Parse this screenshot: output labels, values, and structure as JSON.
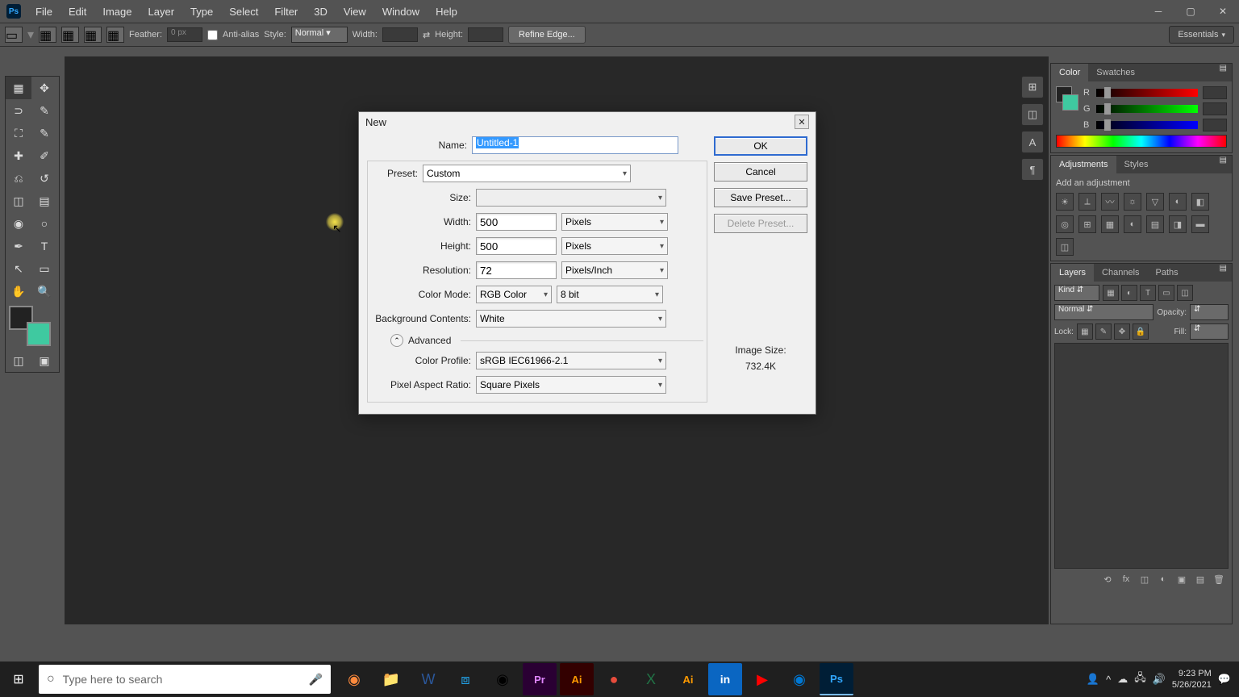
{
  "menu": [
    "File",
    "Edit",
    "Image",
    "Layer",
    "Type",
    "Select",
    "Filter",
    "3D",
    "View",
    "Window",
    "Help"
  ],
  "options": {
    "feather_label": "Feather:",
    "feather_value": "0 px",
    "antialias_label": "Anti-alias",
    "style_label": "Style:",
    "style_value": "Normal",
    "width_label": "Width:",
    "height_label": "Height:",
    "refine_label": "Refine Edge...",
    "workspace": "Essentials"
  },
  "dialog": {
    "title": "New",
    "name_label": "Name:",
    "name_value": "Untitled-1",
    "preset_label": "Preset:",
    "preset_value": "Custom",
    "size_label": "Size:",
    "width_label": "Width:",
    "width_value": "500",
    "width_unit": "Pixels",
    "height_label": "Height:",
    "height_value": "500",
    "height_unit": "Pixels",
    "resolution_label": "Resolution:",
    "resolution_value": "72",
    "resolution_unit": "Pixels/Inch",
    "color_mode_label": "Color Mode:",
    "color_mode_value": "RGB Color",
    "color_depth_value": "8 bit",
    "bg_label": "Background Contents:",
    "bg_value": "White",
    "advanced_label": "Advanced",
    "color_profile_label": "Color Profile:",
    "color_profile_value": "sRGB IEC61966-2.1",
    "pixel_aspect_label": "Pixel Aspect Ratio:",
    "pixel_aspect_value": "Square Pixels",
    "ok": "OK",
    "cancel": "Cancel",
    "save_preset": "Save Preset...",
    "delete_preset": "Delete Preset...",
    "image_size_label": "Image Size:",
    "image_size_value": "732.4K"
  },
  "panels": {
    "color_tab": "Color",
    "swatches_tab": "Swatches",
    "adjustments_tab": "Adjustments",
    "styles_tab": "Styles",
    "add_adjustment": "Add an adjustment",
    "layers_tab": "Layers",
    "channels_tab": "Channels",
    "paths_tab": "Paths",
    "kind": "Kind",
    "blend": "Normal",
    "opacity_label": "Opacity:",
    "lock_label": "Lock:",
    "fill_label": "Fill:",
    "r": "R",
    "g": "G",
    "b": "B",
    "ps_abbrev": "Ps"
  },
  "taskbar": {
    "search_placeholder": "Type here to search",
    "time": "9:23 PM",
    "date": "5/26/2021"
  }
}
